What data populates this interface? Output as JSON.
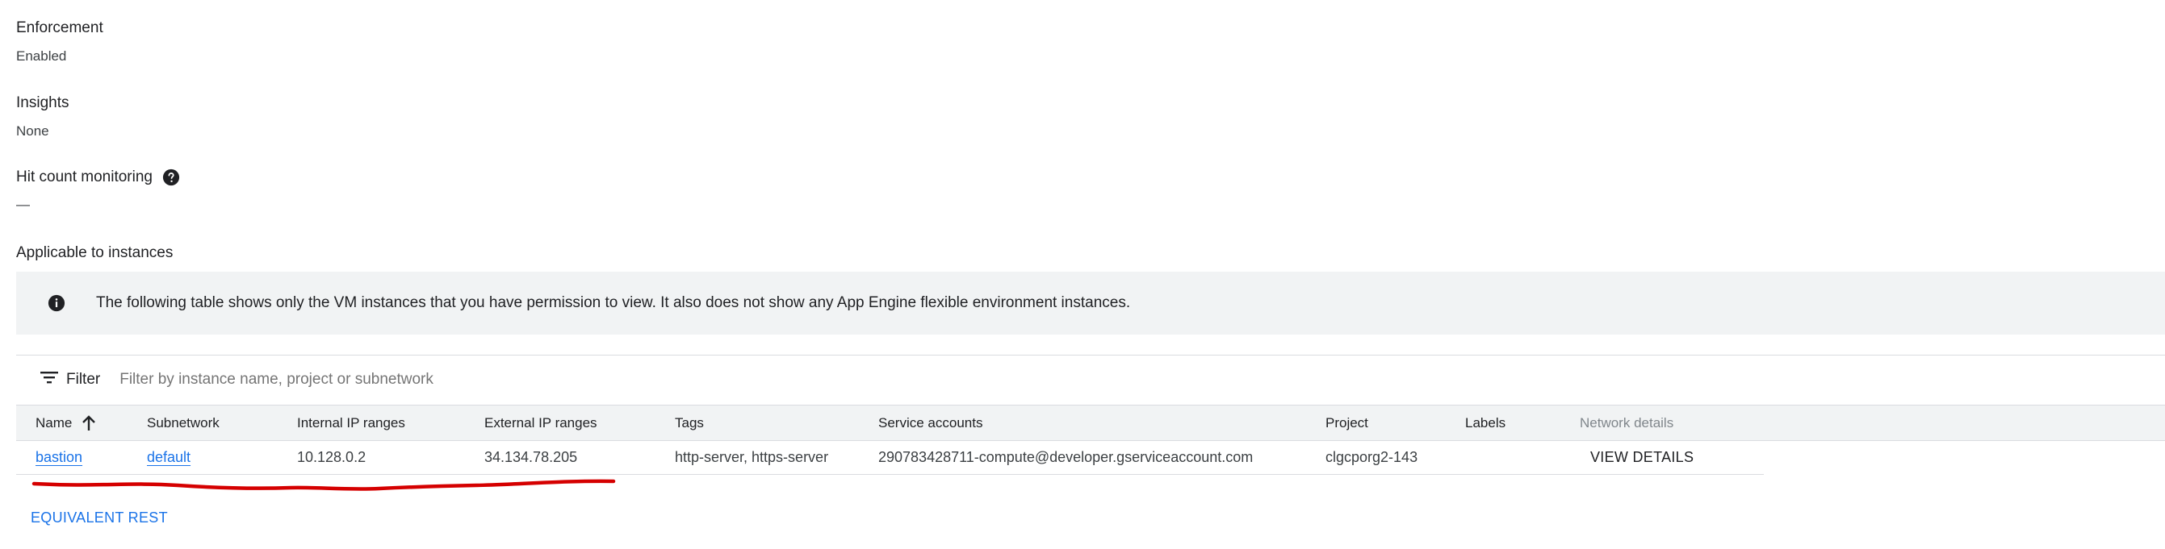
{
  "details": {
    "enforcement_label": "Enforcement",
    "enforcement_value": "Enabled",
    "insights_label": "Insights",
    "insights_value": "None",
    "hit_count_label": "Hit count monitoring",
    "hit_count_value": "—",
    "applicable_label": "Applicable to instances"
  },
  "info_banner": {
    "icon": "info-icon",
    "text": "The following table shows only the VM instances that you have permission to view. It also does not show any App Engine flexible environment instances."
  },
  "filter": {
    "label": "Filter",
    "placeholder": "Filter by instance name, project or subnetwork",
    "icon": "filter-list-icon"
  },
  "table": {
    "columns": [
      "Name",
      "Subnetwork",
      "Internal IP ranges",
      "External IP ranges",
      "Tags",
      "Service accounts",
      "Project",
      "Labels",
      "Network details"
    ],
    "sort": {
      "column": "Name",
      "direction": "ascending"
    },
    "rows": [
      {
        "name": "bastion",
        "subnetwork": "default",
        "internal_ip": "10.128.0.2",
        "external_ip": "34.134.78.205",
        "tags": "http-server, https-server",
        "service_account": "290783428711-compute@developer.gserviceaccount.com",
        "project": "clgcporg2-143",
        "labels": "",
        "network_details": "VIEW DETAILS"
      }
    ]
  },
  "footer": {
    "equivalent_rest": "EQUIVALENT REST"
  },
  "colors": {
    "link": "#1a73e8",
    "banner_bg": "#f1f3f4",
    "annotation_stroke": "#d50000"
  }
}
